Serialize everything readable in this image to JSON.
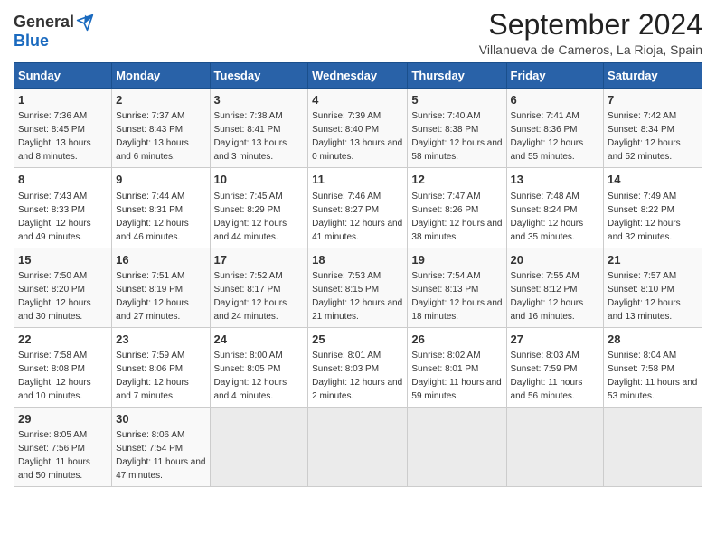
{
  "logo": {
    "general": "General",
    "blue": "Blue"
  },
  "title": "September 2024",
  "subtitle": "Villanueva de Cameros, La Rioja, Spain",
  "days_of_week": [
    "Sunday",
    "Monday",
    "Tuesday",
    "Wednesday",
    "Thursday",
    "Friday",
    "Saturday"
  ],
  "weeks": [
    [
      {
        "day": "1",
        "sunrise": "7:36 AM",
        "sunset": "8:45 PM",
        "daylight": "13 hours and 8 minutes."
      },
      {
        "day": "2",
        "sunrise": "7:37 AM",
        "sunset": "8:43 PM",
        "daylight": "13 hours and 6 minutes."
      },
      {
        "day": "3",
        "sunrise": "7:38 AM",
        "sunset": "8:41 PM",
        "daylight": "13 hours and 3 minutes."
      },
      {
        "day": "4",
        "sunrise": "7:39 AM",
        "sunset": "8:40 PM",
        "daylight": "13 hours and 0 minutes."
      },
      {
        "day": "5",
        "sunrise": "7:40 AM",
        "sunset": "8:38 PM",
        "daylight": "12 hours and 58 minutes."
      },
      {
        "day": "6",
        "sunrise": "7:41 AM",
        "sunset": "8:36 PM",
        "daylight": "12 hours and 55 minutes."
      },
      {
        "day": "7",
        "sunrise": "7:42 AM",
        "sunset": "8:34 PM",
        "daylight": "12 hours and 52 minutes."
      }
    ],
    [
      {
        "day": "8",
        "sunrise": "7:43 AM",
        "sunset": "8:33 PM",
        "daylight": "12 hours and 49 minutes."
      },
      {
        "day": "9",
        "sunrise": "7:44 AM",
        "sunset": "8:31 PM",
        "daylight": "12 hours and 46 minutes."
      },
      {
        "day": "10",
        "sunrise": "7:45 AM",
        "sunset": "8:29 PM",
        "daylight": "12 hours and 44 minutes."
      },
      {
        "day": "11",
        "sunrise": "7:46 AM",
        "sunset": "8:27 PM",
        "daylight": "12 hours and 41 minutes."
      },
      {
        "day": "12",
        "sunrise": "7:47 AM",
        "sunset": "8:26 PM",
        "daylight": "12 hours and 38 minutes."
      },
      {
        "day": "13",
        "sunrise": "7:48 AM",
        "sunset": "8:24 PM",
        "daylight": "12 hours and 35 minutes."
      },
      {
        "day": "14",
        "sunrise": "7:49 AM",
        "sunset": "8:22 PM",
        "daylight": "12 hours and 32 minutes."
      }
    ],
    [
      {
        "day": "15",
        "sunrise": "7:50 AM",
        "sunset": "8:20 PM",
        "daylight": "12 hours and 30 minutes."
      },
      {
        "day": "16",
        "sunrise": "7:51 AM",
        "sunset": "8:19 PM",
        "daylight": "12 hours and 27 minutes."
      },
      {
        "day": "17",
        "sunrise": "7:52 AM",
        "sunset": "8:17 PM",
        "daylight": "12 hours and 24 minutes."
      },
      {
        "day": "18",
        "sunrise": "7:53 AM",
        "sunset": "8:15 PM",
        "daylight": "12 hours and 21 minutes."
      },
      {
        "day": "19",
        "sunrise": "7:54 AM",
        "sunset": "8:13 PM",
        "daylight": "12 hours and 18 minutes."
      },
      {
        "day": "20",
        "sunrise": "7:55 AM",
        "sunset": "8:12 PM",
        "daylight": "12 hours and 16 minutes."
      },
      {
        "day": "21",
        "sunrise": "7:57 AM",
        "sunset": "8:10 PM",
        "daylight": "12 hours and 13 minutes."
      }
    ],
    [
      {
        "day": "22",
        "sunrise": "7:58 AM",
        "sunset": "8:08 PM",
        "daylight": "12 hours and 10 minutes."
      },
      {
        "day": "23",
        "sunrise": "7:59 AM",
        "sunset": "8:06 PM",
        "daylight": "12 hours and 7 minutes."
      },
      {
        "day": "24",
        "sunrise": "8:00 AM",
        "sunset": "8:05 PM",
        "daylight": "12 hours and 4 minutes."
      },
      {
        "day": "25",
        "sunrise": "8:01 AM",
        "sunset": "8:03 PM",
        "daylight": "12 hours and 2 minutes."
      },
      {
        "day": "26",
        "sunrise": "8:02 AM",
        "sunset": "8:01 PM",
        "daylight": "11 hours and 59 minutes."
      },
      {
        "day": "27",
        "sunrise": "8:03 AM",
        "sunset": "7:59 PM",
        "daylight": "11 hours and 56 minutes."
      },
      {
        "day": "28",
        "sunrise": "8:04 AM",
        "sunset": "7:58 PM",
        "daylight": "11 hours and 53 minutes."
      }
    ],
    [
      {
        "day": "29",
        "sunrise": "8:05 AM",
        "sunset": "7:56 PM",
        "daylight": "11 hours and 50 minutes."
      },
      {
        "day": "30",
        "sunrise": "8:06 AM",
        "sunset": "7:54 PM",
        "daylight": "11 hours and 47 minutes."
      },
      null,
      null,
      null,
      null,
      null
    ]
  ]
}
